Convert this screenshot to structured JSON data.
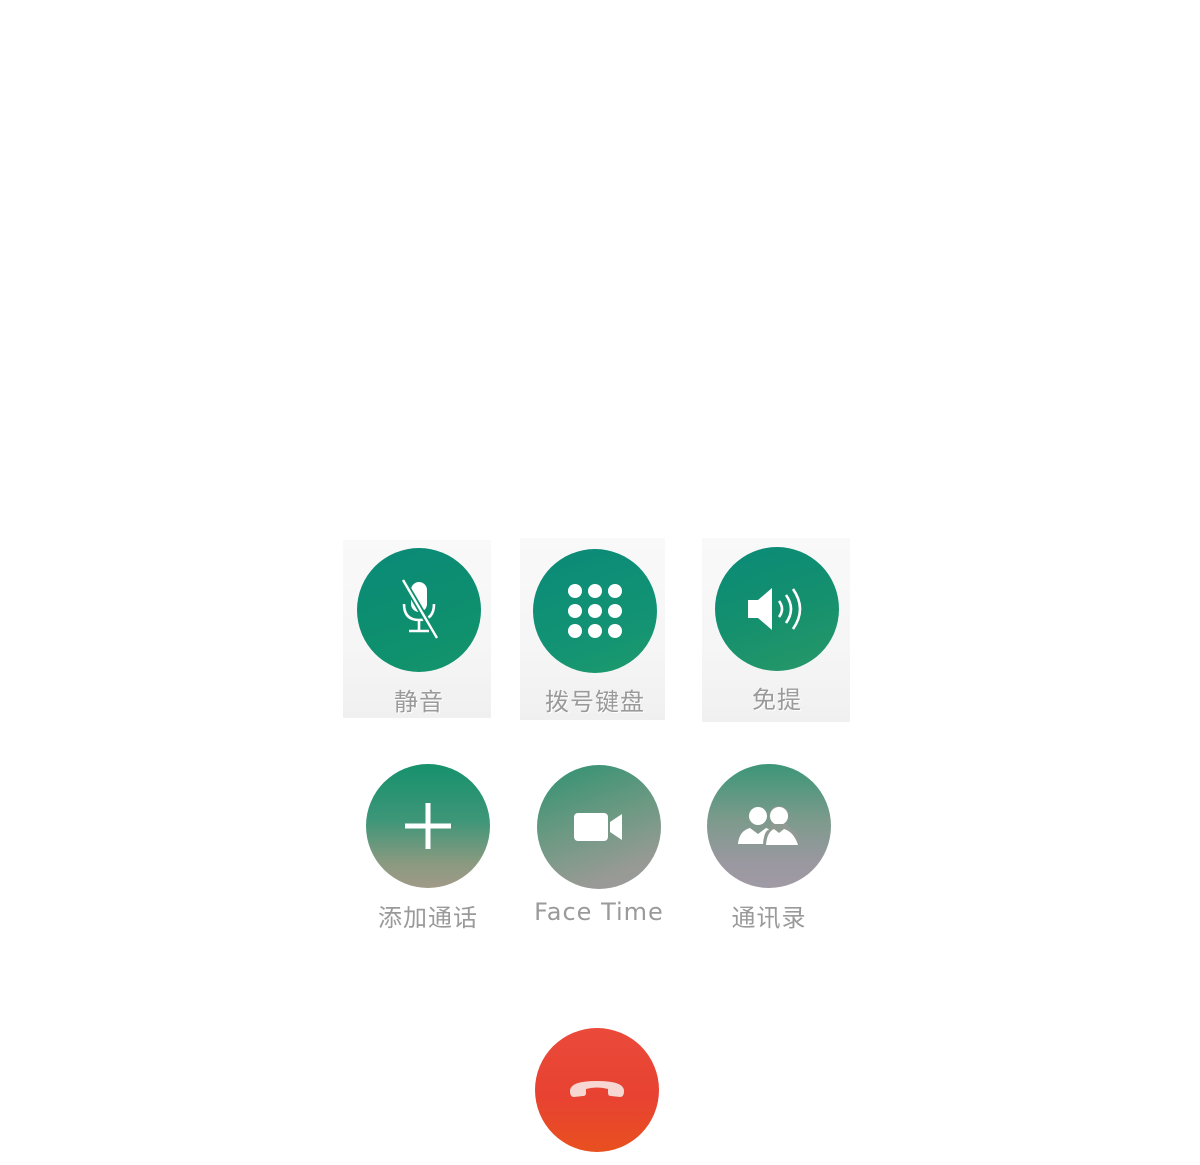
{
  "controls": {
    "mute": {
      "label": "静音",
      "icon": "mic-off-icon"
    },
    "keypad": {
      "label": "拨号键盘",
      "icon": "keypad-icon"
    },
    "speaker": {
      "label": "免提",
      "icon": "speaker-icon"
    },
    "add_call": {
      "label": "添加通话",
      "icon": "plus-icon"
    },
    "facetime": {
      "label": "Face Time",
      "icon": "video-camera-icon"
    },
    "contacts": {
      "label": "通讯录",
      "icon": "contacts-icon"
    }
  },
  "end_call": {
    "icon": "hang-up-icon"
  },
  "colors": {
    "button_green": "#0e8f6e",
    "end_call_red": "#e8432f",
    "label_gray": "#9a9a9a",
    "icon_white": "#ffffff"
  }
}
